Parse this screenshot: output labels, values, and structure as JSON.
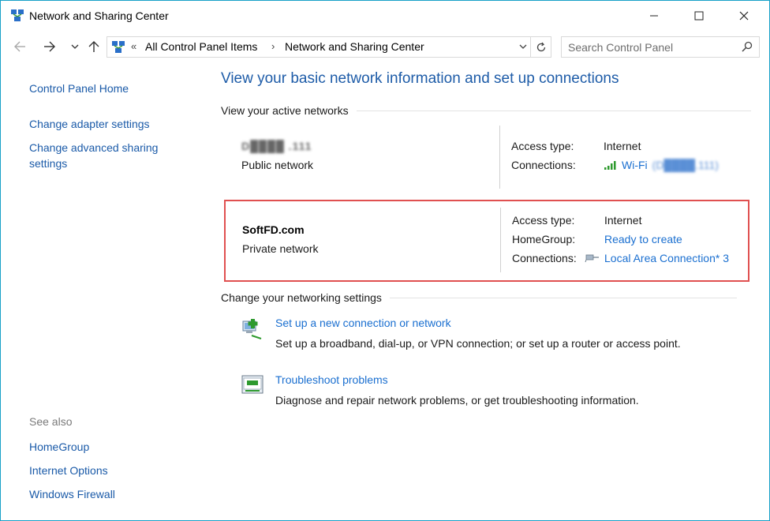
{
  "window": {
    "title": "Network and Sharing Center"
  },
  "address": {
    "crumbs": [
      "All Control Panel Items",
      "Network and Sharing Center"
    ],
    "chevron": "«",
    "separator": "›",
    "search_placeholder": "Search Control Panel"
  },
  "sidebar": {
    "home": "Control Panel Home",
    "adapter": "Change adapter settings",
    "advanced": "Change advanced sharing settings",
    "see_also": "See also",
    "links": [
      "HomeGroup",
      "Internet Options",
      "Windows Firewall"
    ]
  },
  "main": {
    "heading": "View your basic network information and set up connections",
    "active_networks_label": "View your active networks",
    "networks": [
      {
        "name": "D████ .111",
        "category": "Public network",
        "access_type_label": "Access type:",
        "access_type": "Internet",
        "connections_label": "Connections:",
        "connection": "Wi-Fi",
        "connection_suffix": "(D████.111)",
        "connection_icon": "wifi-signal-icon"
      },
      {
        "name": "SoftFD.com",
        "category": "Private network",
        "access_type_label": "Access type:",
        "access_type": "Internet",
        "homegroup_label": "HomeGroup:",
        "homegroup": "Ready to create",
        "connections_label": "Connections:",
        "connection": "Local Area Connection* 3",
        "connection_icon": "ethernet-cable-icon"
      }
    ],
    "change_settings_label": "Change your networking settings",
    "tasks": [
      {
        "link": "Set up a new connection or network",
        "desc": "Set up a broadband, dial-up, or VPN connection; or set up a router or access point.",
        "icon": "new-connection-icon"
      },
      {
        "link": "Troubleshoot problems",
        "desc": "Diagnose and repair network problems, or get troubleshooting information.",
        "icon": "troubleshoot-icon"
      }
    ]
  },
  "colors": {
    "link": "#1a6fd0",
    "heading": "#1e5ca8",
    "highlight_border": "#e05050",
    "window_border": "#18a0c8"
  }
}
